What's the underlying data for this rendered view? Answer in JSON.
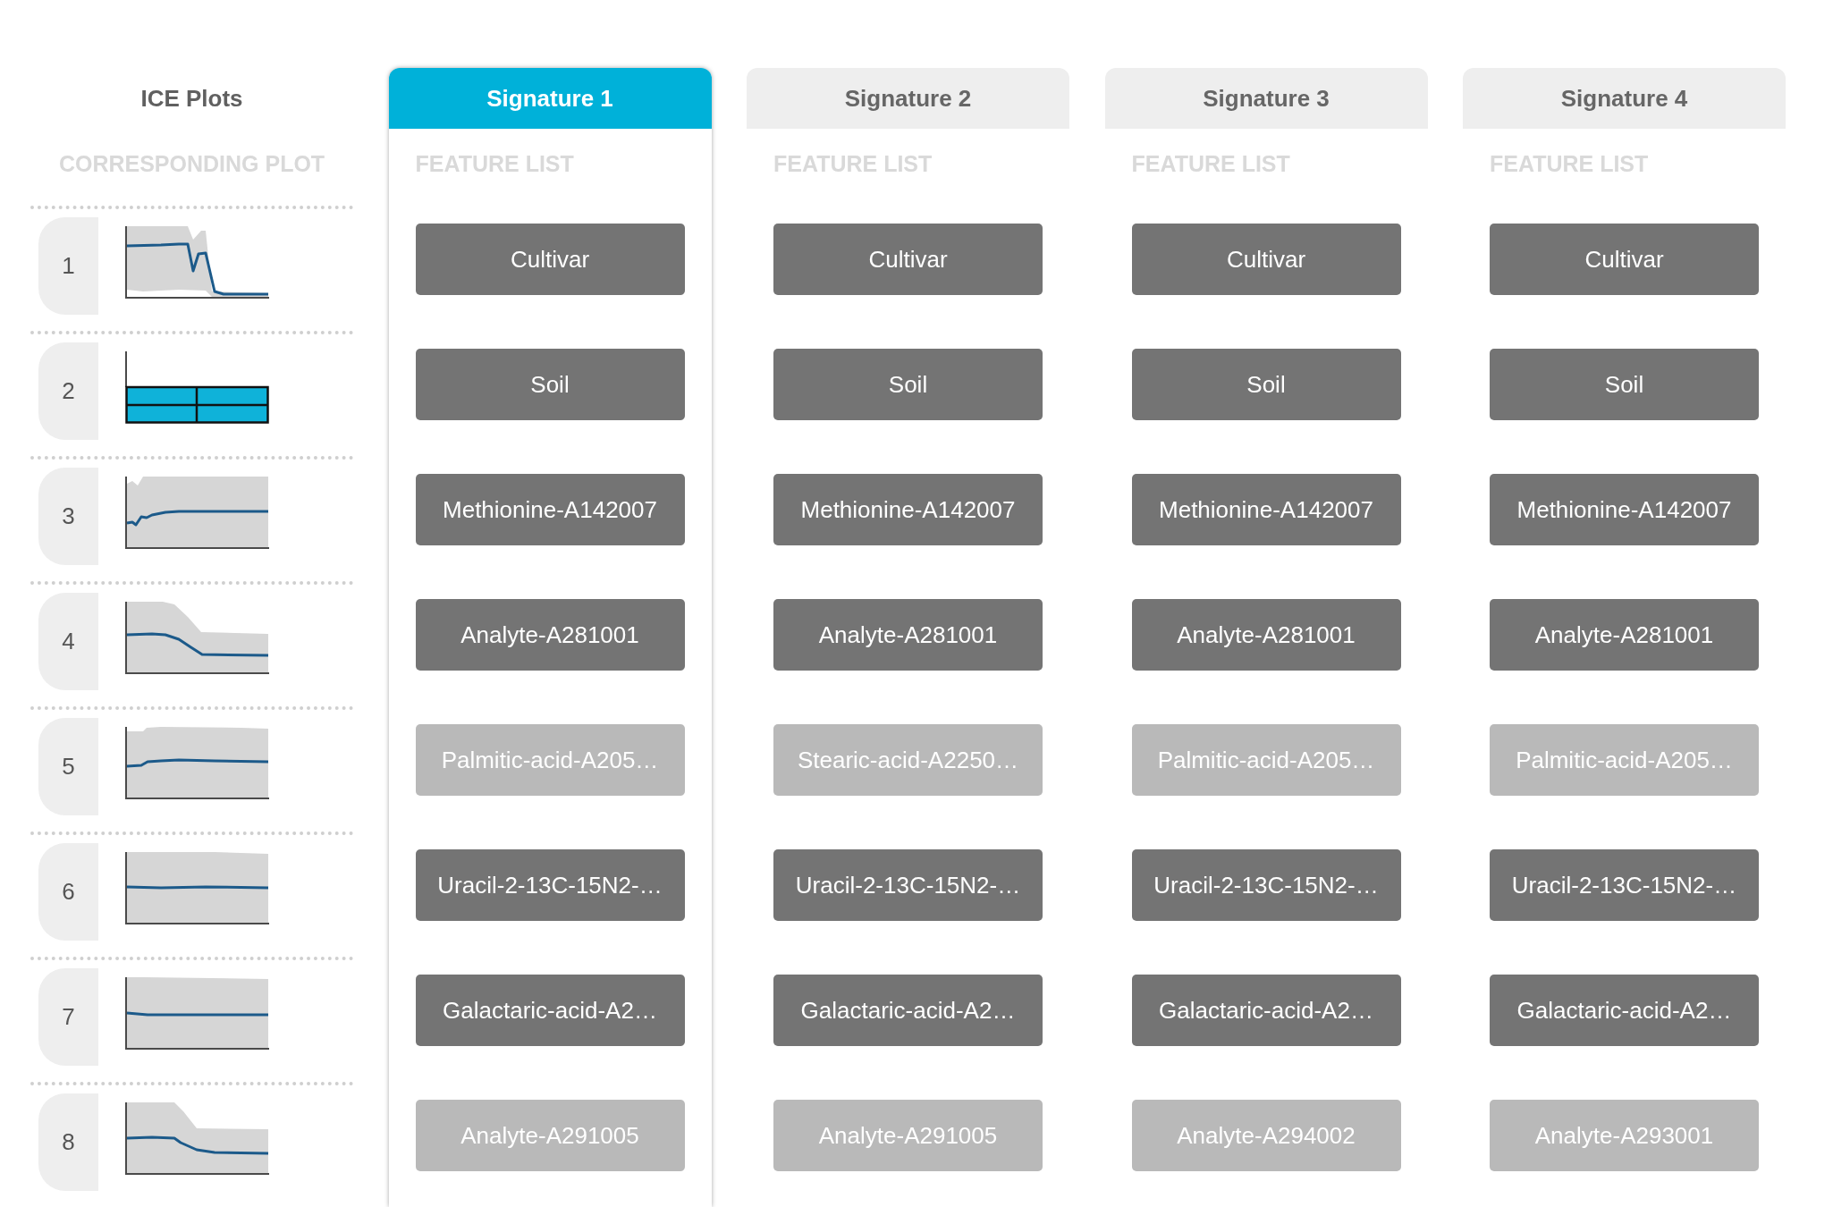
{
  "ice_plots": {
    "title": "ICE Plots",
    "subtitle": "CORRESPONDING PLOT",
    "rows": [
      {
        "number": "1",
        "kind": "line"
      },
      {
        "number": "2",
        "kind": "blocks"
      },
      {
        "number": "3",
        "kind": "line"
      },
      {
        "number": "4",
        "kind": "line"
      },
      {
        "number": "5",
        "kind": "line"
      },
      {
        "number": "6",
        "kind": "line"
      },
      {
        "number": "7",
        "kind": "line"
      },
      {
        "number": "8",
        "kind": "line"
      }
    ]
  },
  "signatures": [
    {
      "label": "Signature 1",
      "selected": true,
      "subtitle": "FEATURE LIST",
      "features": [
        {
          "label": "Cultivar",
          "dimmed": false
        },
        {
          "label": "Soil",
          "dimmed": false
        },
        {
          "label": "Methionine-A142007",
          "dimmed": false
        },
        {
          "label": "Analyte-A281001",
          "dimmed": false
        },
        {
          "label": "Palmitic-acid-A205…",
          "dimmed": true
        },
        {
          "label": "Uracil-2-13C-15N2-…",
          "dimmed": false
        },
        {
          "label": "Galactaric-acid-A2…",
          "dimmed": false
        },
        {
          "label": "Analyte-A291005",
          "dimmed": true
        }
      ]
    },
    {
      "label": "Signature 2",
      "selected": false,
      "subtitle": "FEATURE LIST",
      "features": [
        {
          "label": "Cultivar",
          "dimmed": false
        },
        {
          "label": "Soil",
          "dimmed": false
        },
        {
          "label": "Methionine-A142007",
          "dimmed": false
        },
        {
          "label": "Analyte-A281001",
          "dimmed": false
        },
        {
          "label": "Stearic-acid-A2250…",
          "dimmed": true
        },
        {
          "label": "Uracil-2-13C-15N2-…",
          "dimmed": false
        },
        {
          "label": "Galactaric-acid-A2…",
          "dimmed": false
        },
        {
          "label": "Analyte-A291005",
          "dimmed": true
        }
      ]
    },
    {
      "label": "Signature 3",
      "selected": false,
      "subtitle": "FEATURE LIST",
      "features": [
        {
          "label": "Cultivar",
          "dimmed": false
        },
        {
          "label": "Soil",
          "dimmed": false
        },
        {
          "label": "Methionine-A142007",
          "dimmed": false
        },
        {
          "label": "Analyte-A281001",
          "dimmed": false
        },
        {
          "label": "Palmitic-acid-A205…",
          "dimmed": true
        },
        {
          "label": "Uracil-2-13C-15N2-…",
          "dimmed": false
        },
        {
          "label": "Galactaric-acid-A2…",
          "dimmed": false
        },
        {
          "label": "Analyte-A294002",
          "dimmed": true
        }
      ]
    },
    {
      "label": "Signature 4",
      "selected": false,
      "subtitle": "FEATURE LIST",
      "features": [
        {
          "label": "Cultivar",
          "dimmed": false
        },
        {
          "label": "Soil",
          "dimmed": false
        },
        {
          "label": "Methionine-A142007",
          "dimmed": false
        },
        {
          "label": "Analyte-A281001",
          "dimmed": false
        },
        {
          "label": "Palmitic-acid-A205…",
          "dimmed": true
        },
        {
          "label": "Uracil-2-13C-15N2-…",
          "dimmed": false
        },
        {
          "label": "Galactaric-acid-A2…",
          "dimmed": false
        },
        {
          "label": "Analyte-A293001",
          "dimmed": true
        }
      ]
    }
  ]
}
